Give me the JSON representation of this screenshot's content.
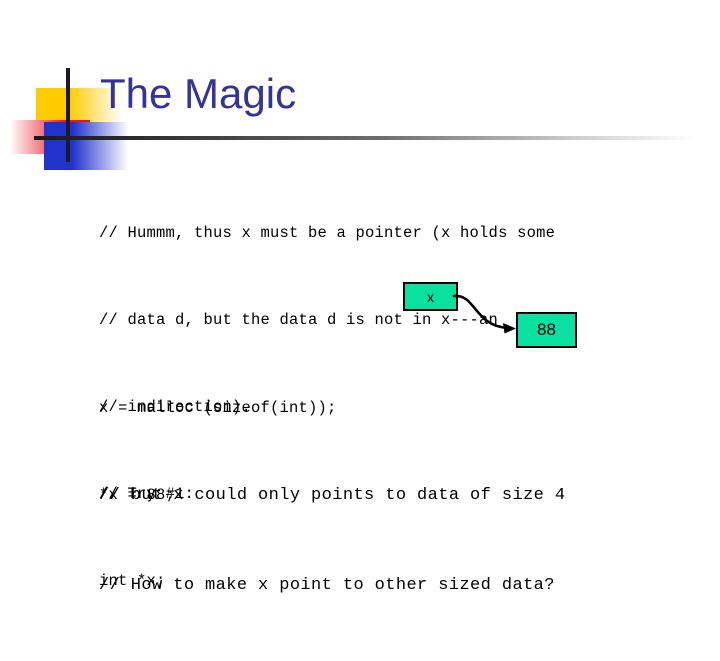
{
  "slide": {
    "title": "The Magic",
    "title_color": "#333399",
    "background_color": "#ffffff"
  },
  "ornament": {
    "yellow_color": "#ffcc00",
    "red_color": "#ee1122",
    "blue_color": "#2233cc",
    "line_color": "#1a1a2e"
  },
  "code_top": {
    "lines": [
      "// Hummm, thus x must be a pointer (x holds some",
      "// data d, but the data d is not in x---an",
      "// indirection).",
      "// Try #1:",
      "int *x;"
    ]
  },
  "code_mid": {
    "lines": [
      "x = malloc (sizeof(int));",
      "*x = 88;"
    ]
  },
  "code_bottom": {
    "lines": [
      "// but x could only points to data of size 4",
      "// How to make x point to other sized data?"
    ]
  },
  "diagram": {
    "pointer_box_label": "x",
    "value_box_label": "88",
    "box_fill_color": "#0ae0a0",
    "box_border_color": "#000000",
    "arrow_color": "#000000"
  }
}
